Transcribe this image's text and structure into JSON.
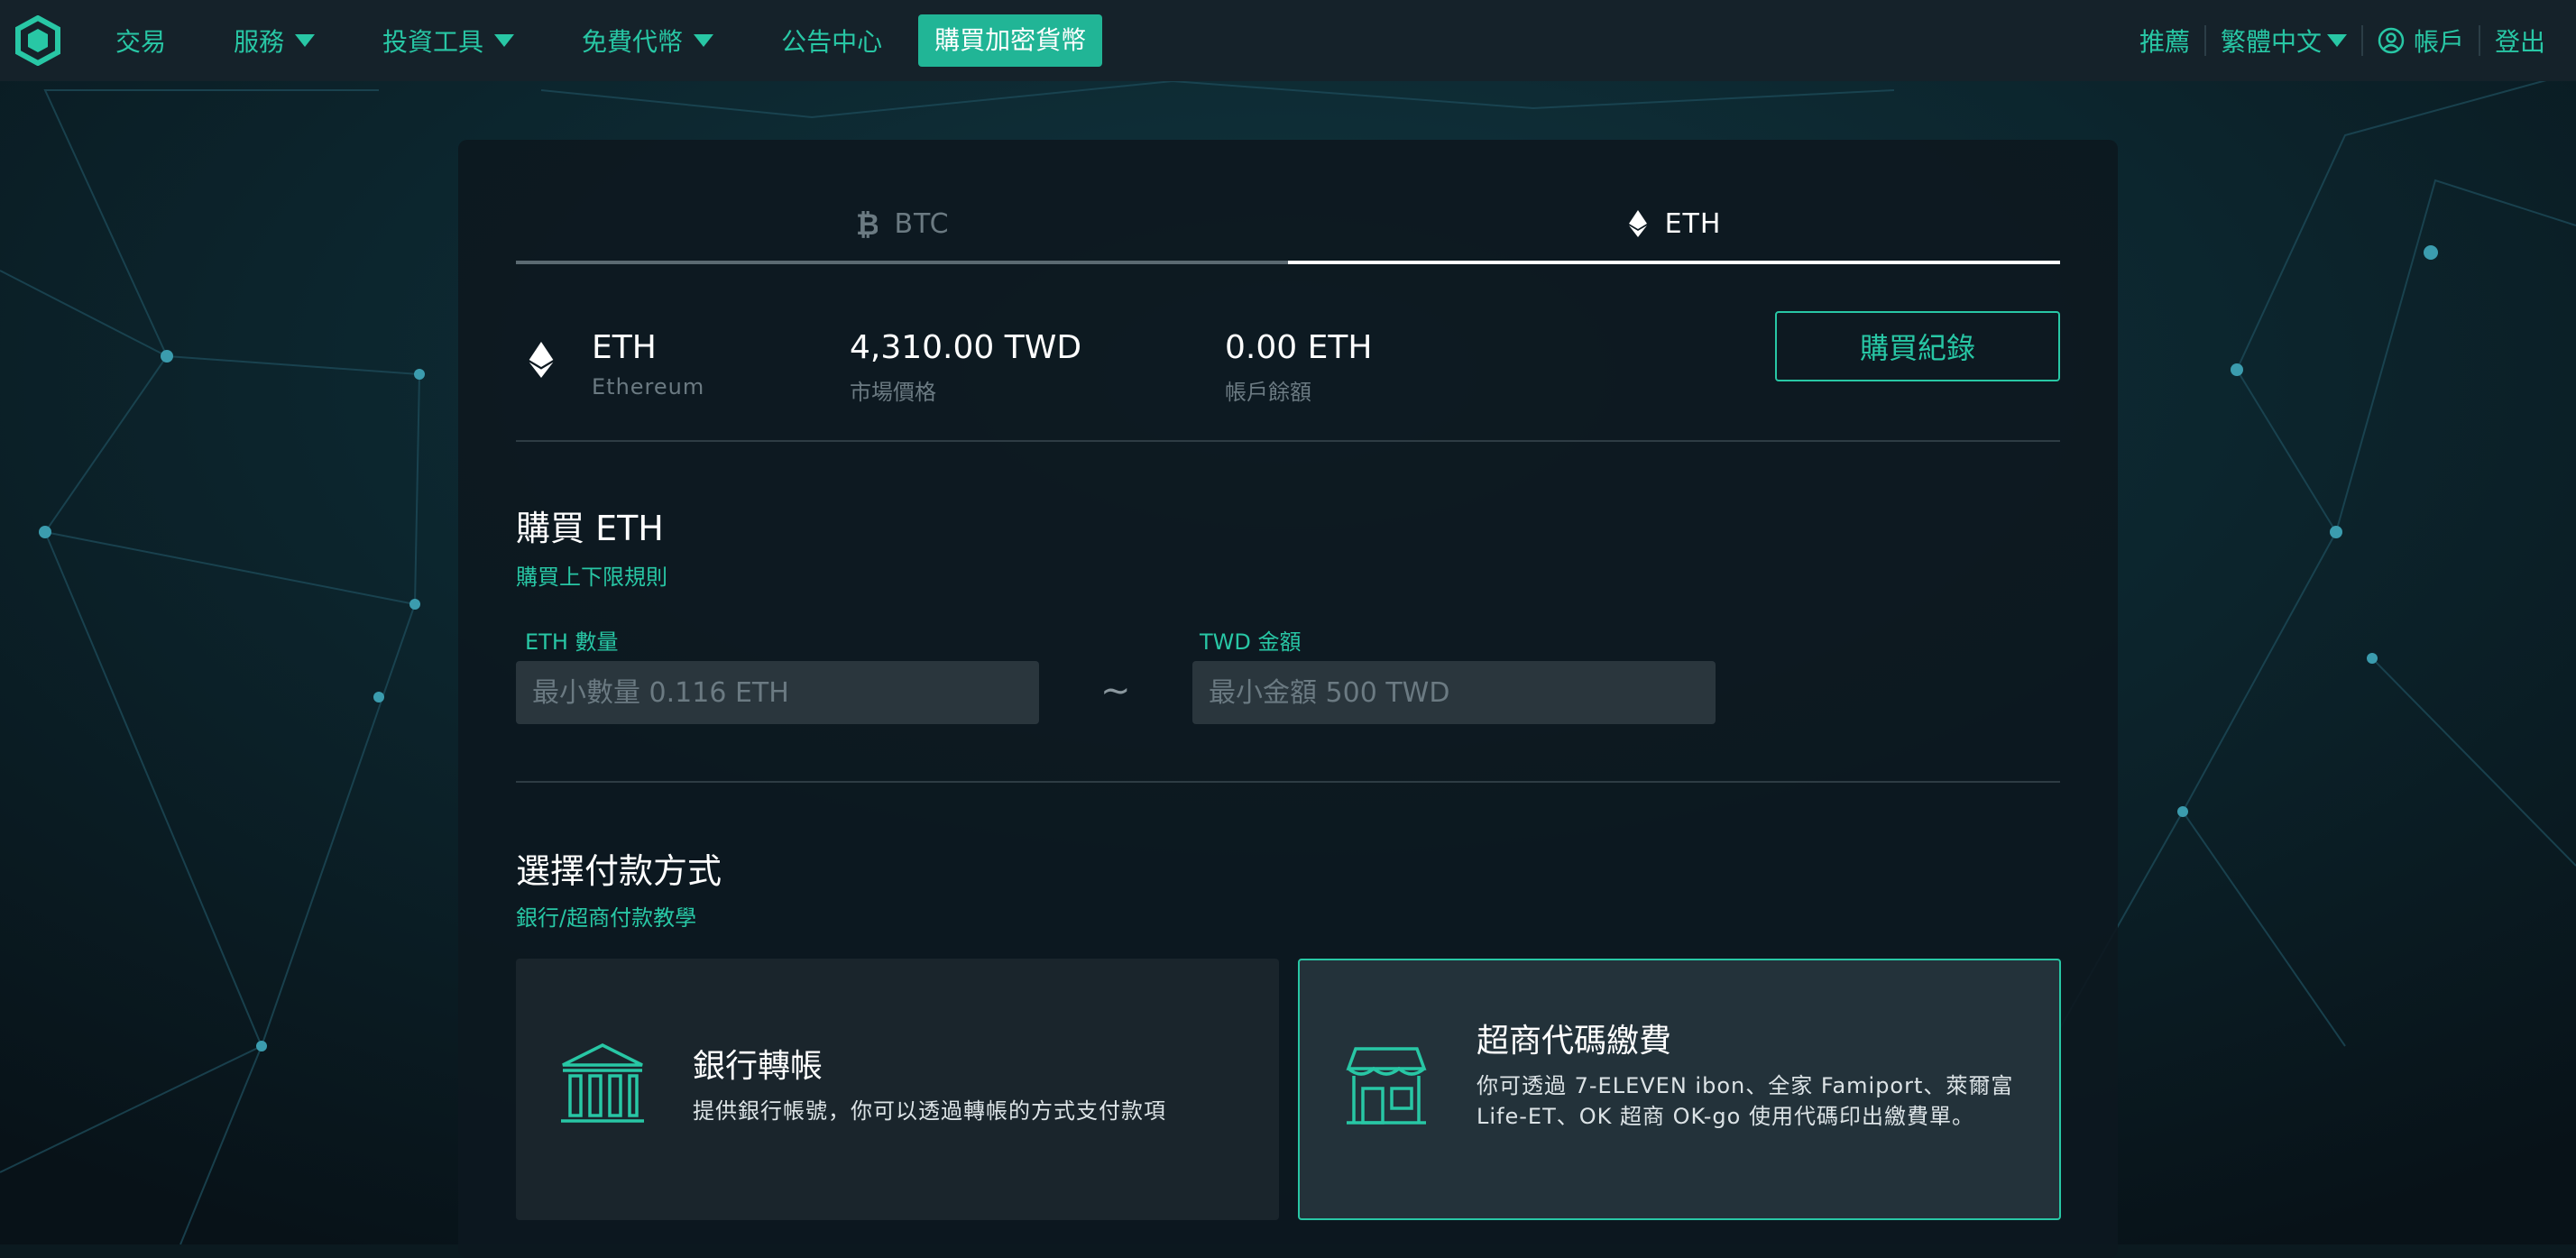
{
  "colors": {
    "accent": "#28c7a5",
    "nav_bg": "#15222a",
    "panel_bg": "#0d181f"
  },
  "nav": {
    "items": [
      {
        "label": "交易",
        "dropdown": false
      },
      {
        "label": "服務",
        "dropdown": true
      },
      {
        "label": "投資工具",
        "dropdown": true
      },
      {
        "label": "免費代幣",
        "dropdown": true
      },
      {
        "label": "公告中心",
        "dropdown": false
      }
    ],
    "buy_button": "購買加密貨幣",
    "right": {
      "referral": "推薦",
      "language": "繁體中文",
      "account": "帳戶",
      "logout": "登出"
    }
  },
  "tabs": {
    "btc": "BTC",
    "eth": "ETH",
    "active": "ETH"
  },
  "coin": {
    "symbol": "ETH",
    "name": "Ethereum",
    "price": "4,310.00 TWD",
    "price_label": "市場價格",
    "balance": "0.00 ETH",
    "balance_label": "帳戶餘額",
    "history_button": "購買紀錄"
  },
  "buy": {
    "title": "購買 ETH",
    "rules_link": "購買上下限規則",
    "qty_label": "ETH 數量",
    "qty_placeholder": "最小數量 0.116 ETH",
    "separator": "~",
    "amt_label": "TWD 金額",
    "amt_placeholder": "最小金額 500 TWD"
  },
  "payment": {
    "title": "選擇付款方式",
    "tutorial_link": "銀行/超商付款教學",
    "methods": [
      {
        "title": "銀行轉帳",
        "desc": "提供銀行帳號，你可以透過轉帳的方式支付款項",
        "icon": "bank-icon",
        "selected": false
      },
      {
        "title": "超商代碼繳費",
        "desc": "你可透過 7-ELEVEN ibon、全家 Famiport、萊爾富 Life-ET、OK 超商 OK-go 使用代碼印出繳費單。",
        "icon": "store-icon",
        "selected": true
      }
    ]
  }
}
